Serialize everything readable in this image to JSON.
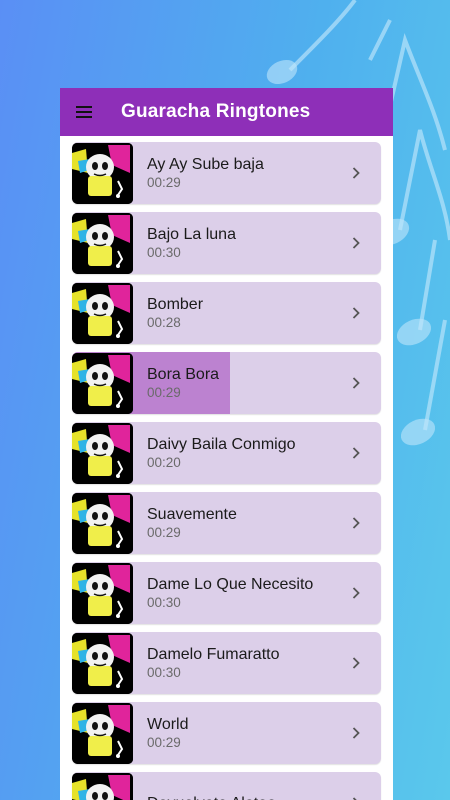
{
  "app": {
    "title": "Guaracha Ringtones",
    "menu_icon": "hamburger-menu-icon"
  },
  "colors": {
    "appbar": "#8e2fb8",
    "item_bg": "#dccfe9",
    "progress_fill": "#bc82d0"
  },
  "ringtones": [
    {
      "name": "Ay Ay Sube baja",
      "duration": "00:29",
      "playback_progress": 0
    },
    {
      "name": "Bajo La luna",
      "duration": "00:30",
      "playback_progress": 0
    },
    {
      "name": "Bomber",
      "duration": "00:28",
      "playback_progress": 0
    },
    {
      "name": "Bora Bora",
      "duration": "00:29",
      "playback_progress": 0.51
    },
    {
      "name": "Daivy Baila Conmigo",
      "duration": "00:20",
      "playback_progress": 0
    },
    {
      "name": "Suavemente",
      "duration": "00:29",
      "playback_progress": 0
    },
    {
      "name": "Dame Lo Que Necesito",
      "duration": "00:30",
      "playback_progress": 0
    },
    {
      "name": "Damelo Fumaratto",
      "duration": "00:30",
      "playback_progress": 0
    },
    {
      "name": "World",
      "duration": "00:29",
      "playback_progress": 0
    },
    {
      "name": "Devuelvete Alotoo",
      "duration": "",
      "playback_progress": 0
    }
  ]
}
